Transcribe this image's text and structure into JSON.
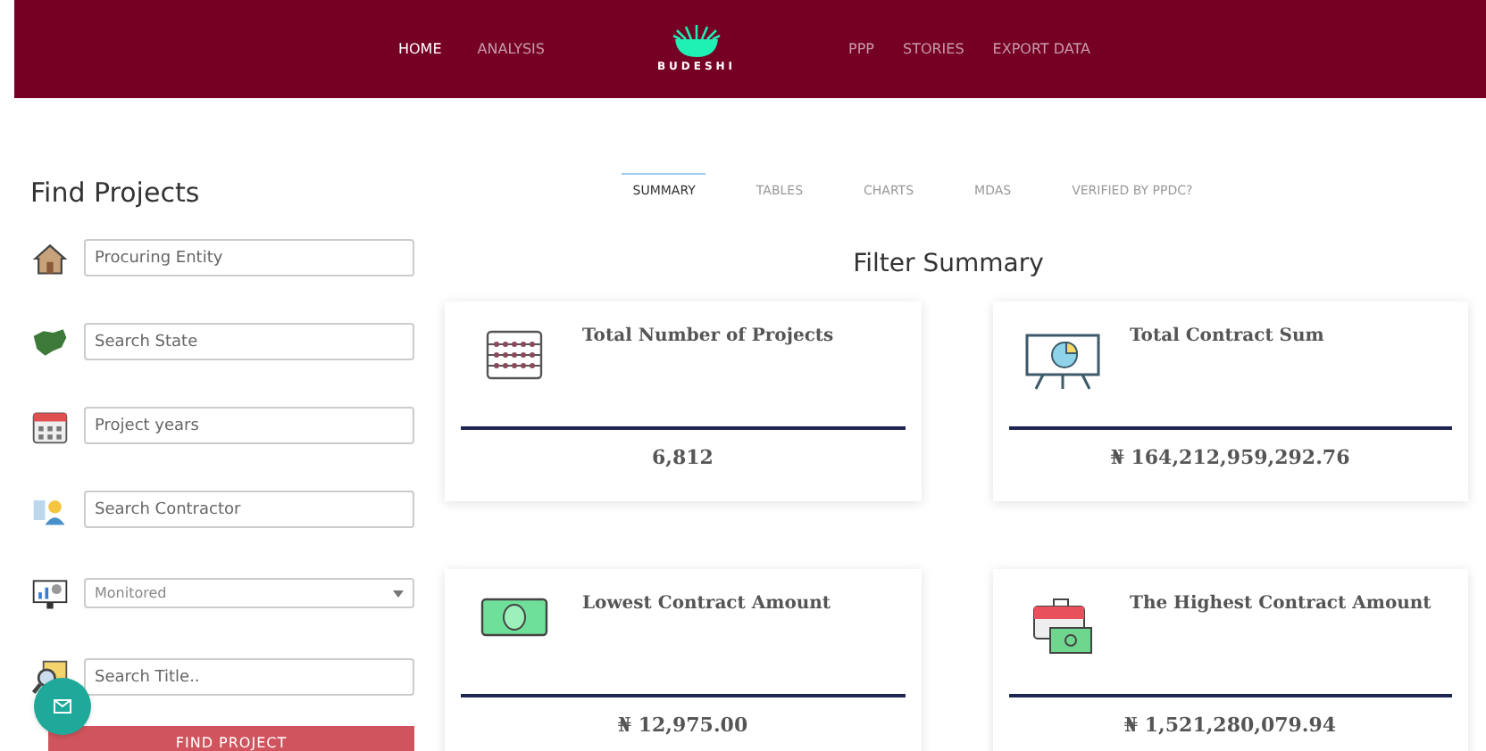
{
  "nav": {
    "left": [
      {
        "label": "HOME",
        "selected": true
      },
      {
        "label": "ANALYSIS",
        "selected": false
      }
    ],
    "logo": "BUDESHI",
    "right": [
      {
        "label": "PPP",
        "selected": false
      },
      {
        "label": "STORIES",
        "selected": false
      },
      {
        "label": "EXPORT DATA",
        "selected": false
      }
    ]
  },
  "sidebar": {
    "title": "Find Projects",
    "fields": [
      {
        "kind": "text",
        "placeholder": "Procuring Entity"
      },
      {
        "kind": "text",
        "placeholder": "Search State"
      },
      {
        "kind": "text",
        "placeholder": "Project years"
      },
      {
        "kind": "text",
        "placeholder": "Search Contractor"
      },
      {
        "kind": "select",
        "value": "Monitored"
      },
      {
        "kind": "text",
        "placeholder": "Search Title.."
      }
    ],
    "button": "FIND PROJECT"
  },
  "tabs": [
    {
      "label": "SUMMARY",
      "selected": true
    },
    {
      "label": "TABLES",
      "selected": false
    },
    {
      "label": "CHARTS",
      "selected": false
    },
    {
      "label": "MDAS",
      "selected": false
    },
    {
      "label": "VERIFIED BY PPDC?",
      "selected": false
    }
  ],
  "heading": "Filter Summary",
  "cards": [
    {
      "title": "Total Number of Projects",
      "value": "6,812"
    },
    {
      "title": "Total Contract Sum",
      "value": "₦ 164,212,959,292.76"
    },
    {
      "title": "Lowest Contract Amount",
      "value": "₦ 12,975.00"
    },
    {
      "title": "The Highest Contract Amount",
      "value": "₦ 1,521,280,079.94"
    }
  ]
}
